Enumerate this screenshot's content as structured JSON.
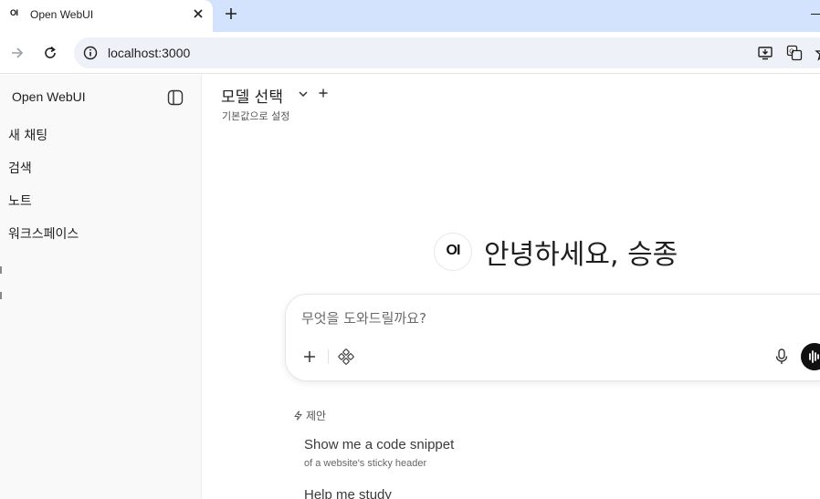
{
  "browser": {
    "tab": {
      "favicon_text": "OI",
      "title": "Open WebUI",
      "close_icon": "close-icon"
    },
    "new_tab_icon": "plus-icon",
    "nav": {
      "forward_icon": "arrow-right-icon",
      "reload_icon": "reload-icon"
    },
    "address": {
      "site_info_icon": "info-icon",
      "url": "localhost:3000"
    },
    "omnibox_icons": [
      "install-app-icon",
      "translate-icon",
      "star-icon"
    ]
  },
  "sidebar": {
    "brand": "Open WebUI",
    "toggle_icon": "sidebar-toggle-icon",
    "items": [
      {
        "label": "새 채팅"
      },
      {
        "label": "검색"
      },
      {
        "label": "노트"
      },
      {
        "label": "워크스페이스"
      }
    ]
  },
  "header": {
    "model_select_label": "모델 선택",
    "chevron_icon": "chevron-down-icon",
    "add_icon": "plus-icon",
    "set_default": "기본값으로 설정"
  },
  "main": {
    "logo_text": "OI",
    "greeting": "안녕하세요, 승종"
  },
  "chat": {
    "placeholder": "무엇을 도와드릴까요?",
    "value": "",
    "plus_icon": "plus-icon",
    "tools_icon": "integrations-icon",
    "mic_icon": "microphone-icon",
    "voice_icon": "voice-mode-icon"
  },
  "suggestions": {
    "header": "제안",
    "header_icon": "bolt-icon",
    "items": [
      {
        "title": "Show me a code snippet",
        "subtitle": "of a website's sticky header"
      },
      {
        "title": "Help me study",
        "subtitle": ""
      }
    ]
  },
  "colors": {
    "tabstrip": "#d3e3fd",
    "omnibox": "#eef1f7",
    "sidebar": "#f9f9f9",
    "voice_button": "#111111"
  }
}
